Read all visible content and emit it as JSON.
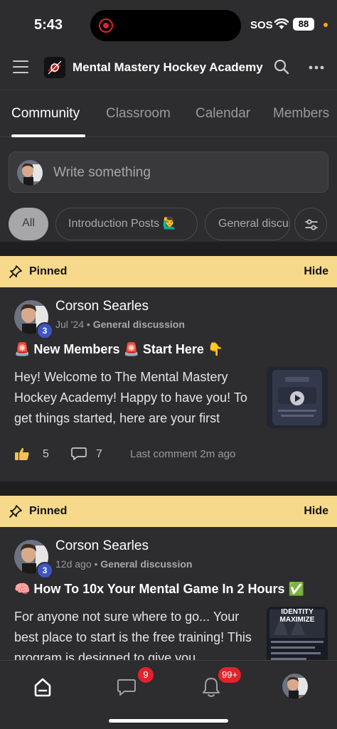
{
  "status": {
    "time": "5:43",
    "sos": "SOS",
    "battery": "88"
  },
  "header": {
    "title": "Mental Mastery Hockey Academy"
  },
  "tabs": [
    {
      "label": "Community"
    },
    {
      "label": "Classroom"
    },
    {
      "label": "Calendar"
    },
    {
      "label": "Members"
    }
  ],
  "composer": {
    "placeholder": "Write something"
  },
  "filters": [
    {
      "label": "All"
    },
    {
      "label": "Introduction Posts 🙋‍♂️"
    },
    {
      "label": "General discussion"
    }
  ],
  "pinned_label": "Pinned",
  "hide_label": "Hide",
  "posts": [
    {
      "author": "Corson Searles",
      "level": "3",
      "time": "Jul '24",
      "category": "General discussion",
      "title": "🚨 New Members 🚨 Start Here 👇",
      "body": "Hey! Welcome to The Mental Mastery Hockey Academy! Happy to have you! To get things started, here are your first",
      "likes": "5",
      "comments": "7",
      "last_comment": "Last comment 2m ago"
    },
    {
      "author": "Corson Searles",
      "level": "3",
      "time": "12d ago",
      "category": "General discussion",
      "title": "🧠 How To 10x Your Mental Game In 2 Hours ✅",
      "body": "For anyone not sure where to go... Your best place to start is the free training! This program is designed to give you",
      "thumb_text": "IDENTITY MAXIMIZE"
    }
  ],
  "bottom_nav": {
    "chat_badge": "9",
    "notif_badge": "99+"
  },
  "colors": {
    "background": "#2d2c2e",
    "pinned": "#f7d98b",
    "level_badge": "#3f55c7",
    "notification": "#e0242a"
  }
}
